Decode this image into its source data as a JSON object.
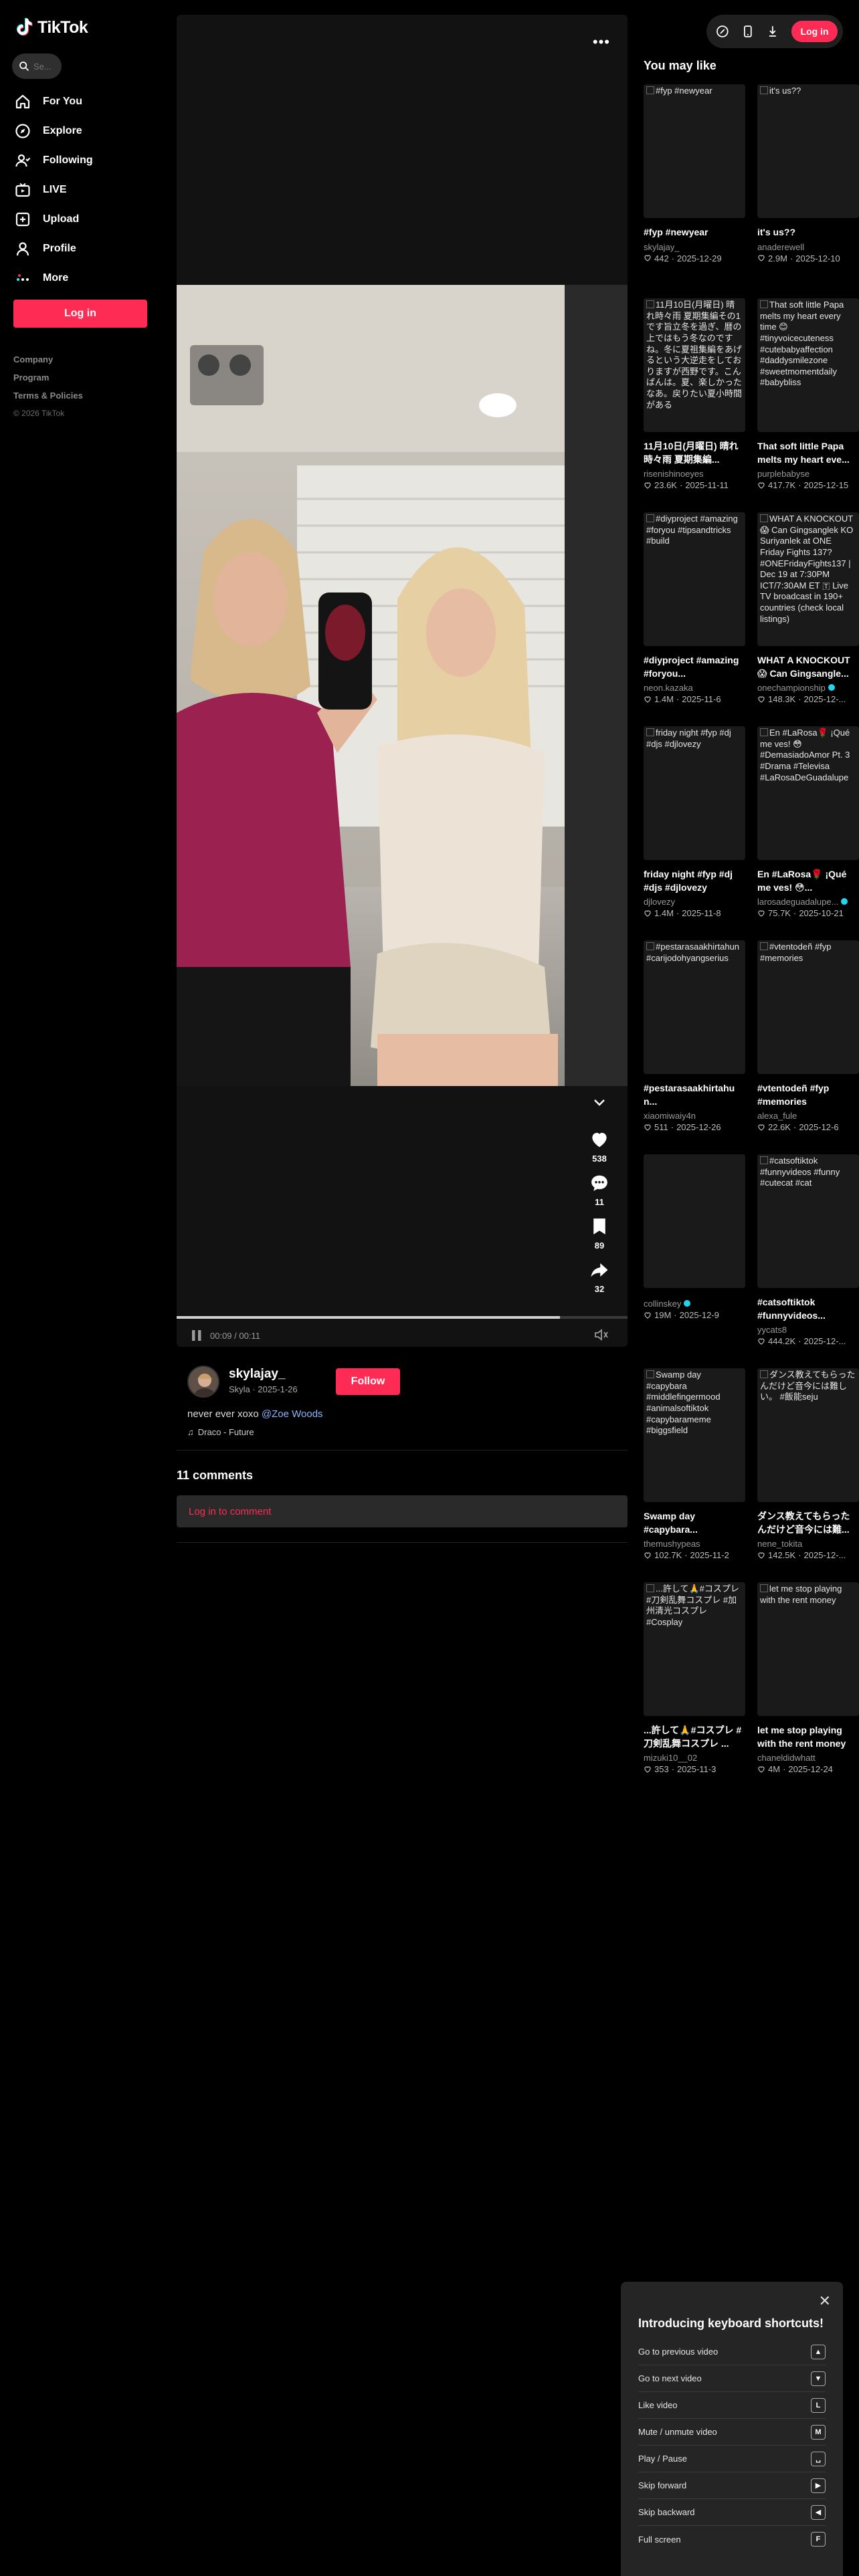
{
  "brand": {
    "name": "TikTok"
  },
  "search": {
    "placeholder": "Se..."
  },
  "sidebar": {
    "items": [
      {
        "label": "For You",
        "icon": "home-icon"
      },
      {
        "label": "Explore",
        "icon": "compass-icon"
      },
      {
        "label": "Following",
        "icon": "following-icon"
      },
      {
        "label": "LIVE",
        "icon": "live-icon"
      },
      {
        "label": "Upload",
        "icon": "upload-icon"
      },
      {
        "label": "Profile",
        "icon": "profile-icon"
      },
      {
        "label": "More",
        "icon": "more-icon"
      }
    ],
    "login_label": "Log in",
    "footer": {
      "company": "Company",
      "program": "Program",
      "terms": "Terms & Policies",
      "copyright": "© 2026 TikTok"
    }
  },
  "topbar": {
    "login_label": "Log in"
  },
  "video": {
    "time_current": "00:09",
    "time_total": "00:11",
    "progress": 0.85,
    "likes": "538",
    "comments": "11",
    "saves": "89",
    "shares": "32"
  },
  "author": {
    "username": "skylajay_",
    "display": "Skyla",
    "date": "2025-1-26",
    "follow_label": "Follow",
    "caption": "never ever xoxo",
    "mention": "@Zoe Woods",
    "music": "Draco - Future"
  },
  "comments": {
    "count_label": "11 comments",
    "login_prompt": "Log in to comment"
  },
  "suggestions": {
    "heading": "You may like",
    "cards": [
      {
        "thumb": "#fyp #newyear",
        "title": "#fyp #newyear",
        "author": "skylajay_",
        "likes": "442",
        "date": "2025-12-29"
      },
      {
        "thumb": "it's us??",
        "title": "it's us??",
        "author": "anaderewell",
        "likes": "2.9M",
        "date": "2025-12-10"
      },
      {
        "thumb": "11月10日(月曜日) 晴れ時々雨 夏期集編その1です旨立冬を過ぎ、暦の上ではもう冬なのですね。冬に夏祖集編をあげるという大逆走をしておりますが西野です。こんばんは。夏、楽しかったなあ。戻りたい夏小時間がある",
        "title": "11月10日(月曜日) 晴れ時々雨 夏期集編...",
        "author": "risenishinoeyes",
        "likes": "23.6K",
        "date": "2025-11-11"
      },
      {
        "thumb": "That soft little Papa melts my heart every time 😊 #tinyvoicecuteness #cutebabyaffection #daddysmilezone #sweetmomentdaily #babybliss",
        "title": "That soft little Papa melts my heart eve...",
        "author": "purplebabyse",
        "likes": "417.7K",
        "date": "2025-12-15"
      },
      {
        "thumb": "#diyproject #amazing #foryou #tipsandtricks #build",
        "title": "#diyproject #amazing #foryou...",
        "author": "neon.kazaka",
        "likes": "1.4M",
        "date": "2025-11-6"
      },
      {
        "thumb": "WHAT A KNOCKOUT 😱 Can Gingsanglek KO Suriyanlek at ONE Friday Fights 137? #ONEFridayFights137 | Dec 19 at 7:30PM ICT/7:30AM ET 🇹 Live TV broadcast in 190+ countries (check local listings)",
        "title": "WHAT A KNOCKOUT 😱 Can Gingsangle...",
        "author": "onechampionship",
        "likes": "148.3K",
        "date": "2025-12-...",
        "verified": true
      },
      {
        "thumb": "friday night #fyp #dj #djs #djlovezy",
        "title": "friday night #fyp #dj #djs #djlovezy",
        "author": "djlovezy",
        "likes": "1.4M",
        "date": "2025-11-8"
      },
      {
        "thumb": "En #LaRosa🌹 ¡Qué me ves! 😳 #DemasiadoAmor Pt. 3 #Drama #Televisa #LaRosaDeGuadalupe",
        "title": "En #LaRosa🌹 ¡Qué me ves! 😳...",
        "author": "larosadeguadalupe...",
        "likes": "75.7K",
        "date": "2025-10-21",
        "verified": true
      },
      {
        "thumb": "#pestarasaakhirtahun #carijodohyangserius",
        "title": "#pestarasaakhirtahu n...",
        "author": "xiaomiwaiy4n",
        "likes": "511",
        "date": "2025-12-26"
      },
      {
        "thumb": "#vtentodeñ #fyp #memories",
        "title": "#vtentodeñ #fyp #memories",
        "author": "alexa_fule",
        "likes": "22.6K",
        "date": "2025-12-6"
      },
      {
        "thumb": "",
        "title": "",
        "author": "collinskey",
        "likes": "19M",
        "date": "2025-12-9",
        "verified": true
      },
      {
        "thumb": "#catsoftiktok #funnyvideos #funny #cutecat #cat",
        "title": "#catsoftiktok #funnyvideos...",
        "author": "yycats8",
        "likes": "444.2K",
        "date": "2025-12-..."
      },
      {
        "thumb": "Swamp day #capybara #middlefingermood #animalsoftiktok #capybarameme #biggsfield",
        "title": "Swamp day #capybara...",
        "author": "themushypeas",
        "likes": "102.7K",
        "date": "2025-11-2"
      },
      {
        "thumb": "ダンス教えてもらったんだけど音今には難しい。 #飯能seju",
        "title": "ダンス教えてもらったんだけど音今には難...",
        "author": "nene_tokita",
        "likes": "142.5K",
        "date": "2025-12-..."
      },
      {
        "thumb": "...許して🙏#コスプレ #刀剣乱舞コスプレ #加州清光コスプレ #Cosplay",
        "title": "...許して🙏#コスプレ #刀剣乱舞コスプレ ...",
        "author": "mizuki10__02",
        "likes": "353",
        "date": "2025-11-3"
      },
      {
        "thumb": "let me stop playing with the rent money",
        "title": "let me stop playing with the rent money",
        "author": "chaneldidwhatt",
        "likes": "4M",
        "date": "2025-12-24"
      }
    ]
  },
  "shortcuts": {
    "title": "Introducing keyboard shortcuts!",
    "rows": [
      {
        "label": "Go to previous video",
        "key": "▲"
      },
      {
        "label": "Go to next video",
        "key": "▼"
      },
      {
        "label": "Like video",
        "key": "L"
      },
      {
        "label": "Mute / unmute video",
        "key": "M"
      },
      {
        "label": "Play / Pause",
        "key": "␣"
      },
      {
        "label": "Skip forward",
        "key": "▶"
      },
      {
        "label": "Skip backward",
        "key": "◀"
      },
      {
        "label": "Full screen",
        "key": "F"
      }
    ]
  }
}
